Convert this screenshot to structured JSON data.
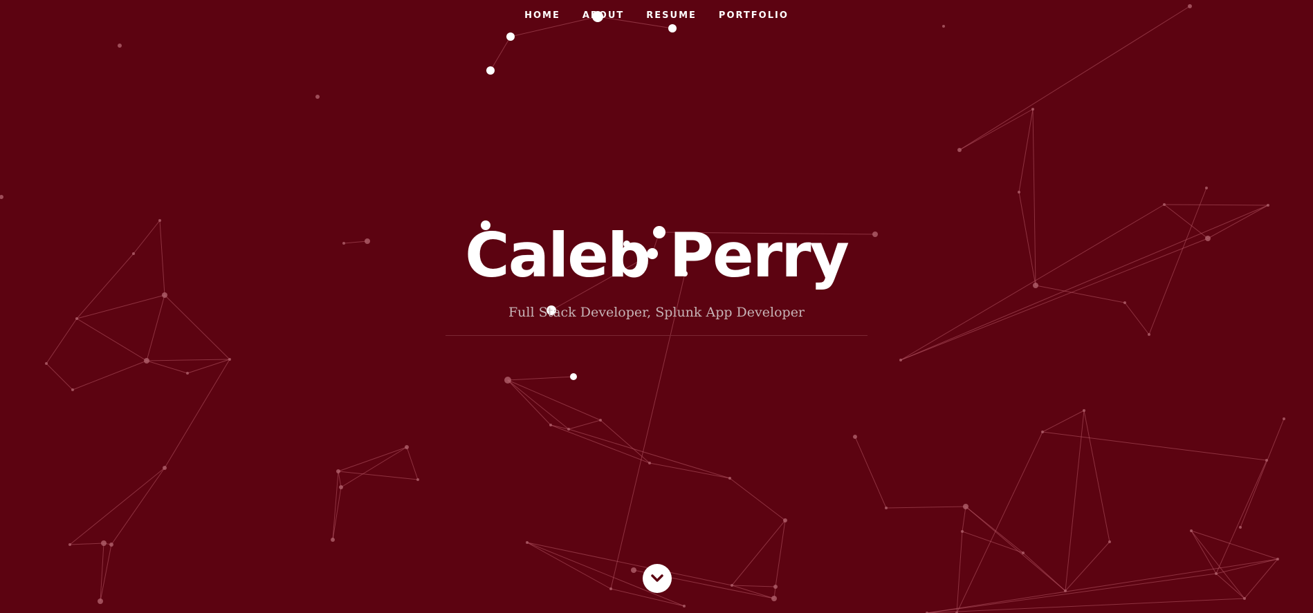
{
  "nav": {
    "items": [
      {
        "label": "HOME"
      },
      {
        "label": "ABOUT"
      },
      {
        "label": "RESUME"
      },
      {
        "label": "PORTFOLIO"
      }
    ]
  },
  "hero": {
    "title": "Caleb Perry",
    "subtitle": "Full Stack Developer, Splunk App Developer"
  },
  "scroll_button": {
    "icon": "chevron-down-icon"
  },
  "colors": {
    "background": "#5c0311",
    "text": "#ffffff",
    "subtitle": "#c7b4b7",
    "particle_line": "#a0505c"
  }
}
